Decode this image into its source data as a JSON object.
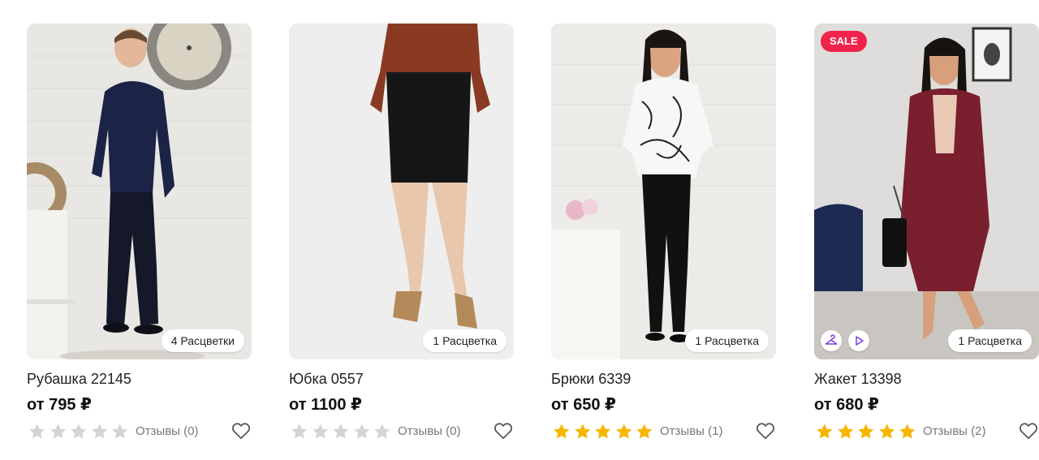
{
  "products": [
    {
      "title": "Рубашка 22145",
      "price": "от 795 ₽",
      "colors_label": "4 Расцветки",
      "rating": 0,
      "reviews_label": "Отзывы (0)",
      "image_icon": "man-in-navy-shirt-photo"
    },
    {
      "title": "Юбка 0557",
      "price": "от 1100 ₽",
      "colors_label": "1 Расцветка",
      "rating": 0,
      "reviews_label": "Отзывы (0)",
      "image_icon": "black-pencil-skirt-photo"
    },
    {
      "title": "Брюки 6339",
      "price": "от 650 ₽",
      "colors_label": "1 Расцветка",
      "rating": 5,
      "reviews_label": "Отзывы (1)",
      "image_icon": "woman-in-black-trousers-photo"
    },
    {
      "title": "Жакет 13398",
      "price": "от 680 ₽",
      "colors_label": "1 Расцветка",
      "rating": 5,
      "reviews_label": "Отзывы (2)",
      "badge": "SALE",
      "image_icon": "woman-in-burgundy-jacket-photo",
      "media_icons": [
        "hanger-icon",
        "play-icon"
      ]
    }
  ],
  "colors": {
    "star_filled": "#f7b500",
    "star_empty": "#d4d4d4",
    "sale": "#f0234a",
    "accent_purple": "#7b3fe4",
    "text": "#222222",
    "muted": "#777777"
  },
  "icons": {
    "favorite": "heart-outline-icon",
    "star": "star-icon"
  }
}
